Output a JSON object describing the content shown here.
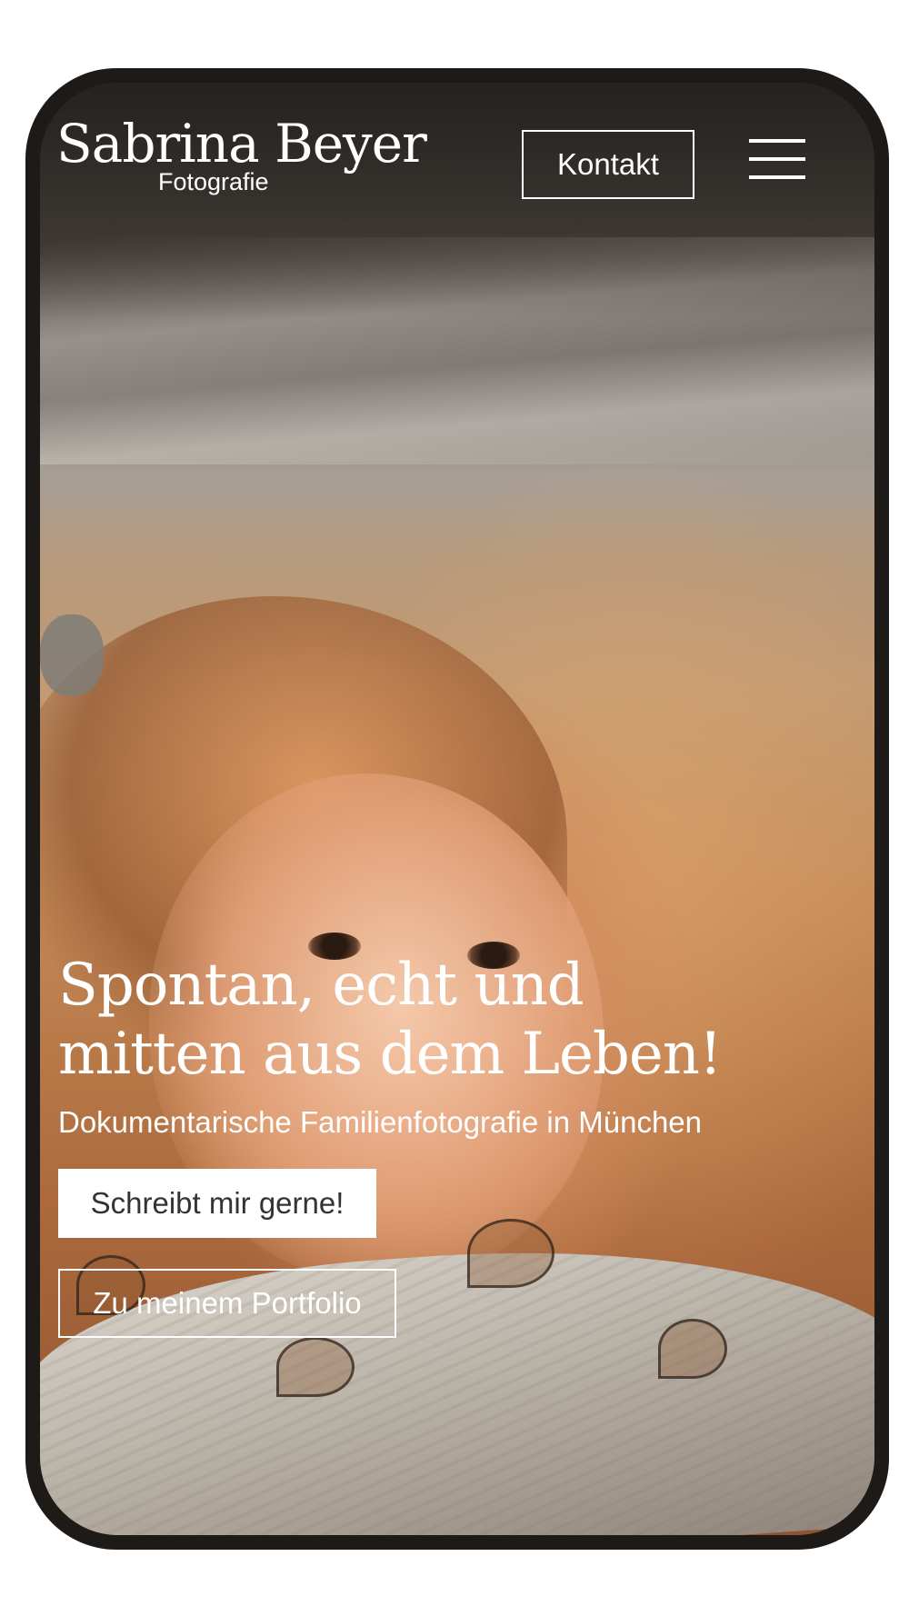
{
  "header": {
    "logo_name": "Sabrina Beyer",
    "logo_subtitle": "Fotografie",
    "contact_label": "Kontakt",
    "menu_icon": "hamburger-menu-icon"
  },
  "hero": {
    "title": "Spontan, echt und mitten aus dem Leben!",
    "subtitle": "Dokumentarische Familienfotografie in München",
    "primary_button": "Schreibt mir gerne!",
    "secondary_button": "Zu meinem Portfolio"
  },
  "colors": {
    "text": "#ffffff",
    "frame": "#1e1a17",
    "button_text_dark": "#333333"
  }
}
